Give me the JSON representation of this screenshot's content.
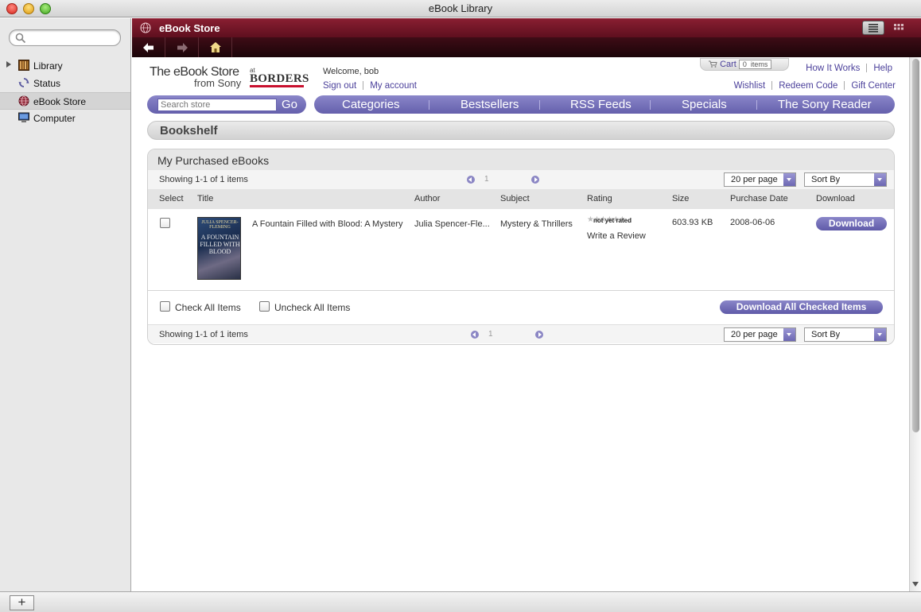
{
  "window": {
    "title": "eBook Library"
  },
  "sidebar": {
    "search_placeholder": "",
    "items": [
      {
        "label": "Library",
        "icon": "library-icon"
      },
      {
        "label": "Status",
        "icon": "sync-icon"
      },
      {
        "label": "eBook Store",
        "icon": "globe-icon"
      },
      {
        "label": "Computer",
        "icon": "computer-icon"
      }
    ],
    "add_label": "+"
  },
  "store": {
    "title": "eBook Store",
    "logo": {
      "line1": "The eBook Store",
      "line2": "from Sony",
      "at": "at",
      "partner": "BORDERS"
    },
    "welcome": "Welcome, bob",
    "sign_out": "Sign out",
    "my_account": "My account",
    "cart": {
      "label": "Cart",
      "count": "0",
      "unit": "items"
    },
    "how_it_works": "How It Works",
    "help": "Help",
    "wishlist": "Wishlist",
    "redeem": "Redeem Code",
    "gift": "Gift Center",
    "search": {
      "placeholder": "Search store",
      "go": "Go"
    },
    "menu": [
      "Categories",
      "Bestsellers",
      "RSS Feeds",
      "Specials",
      "The Sony Reader"
    ]
  },
  "bookshelf": {
    "title": "Bookshelf",
    "panel_title": "My Purchased eBooks",
    "showing": "Showing 1-1 of 1 items",
    "page": "1",
    "per_page": "20 per page",
    "sort_by": "Sort By",
    "columns": [
      "Select",
      "Title",
      "Author",
      "Subject",
      "Rating",
      "Size",
      "Purchase Date",
      "Download"
    ],
    "rows": [
      {
        "title": "A Fountain Filled with Blood: A Mystery",
        "author": "Julia Spencer-Fle...",
        "subject": "Mystery & Thrillers",
        "rating": "not yet rated",
        "write_review": "Write a Review",
        "size": "603.93 KB",
        "purchase_date": "2008-06-06",
        "download": "Download",
        "cover_author": "JULIA SPENCER-FLEMING",
        "cover_title": "A FOUNTAIN FILLED WITH BLOOD"
      }
    ],
    "check_all": "Check All Items",
    "uncheck_all": "Uncheck All Items",
    "download_all": "Download All Checked Items"
  }
}
